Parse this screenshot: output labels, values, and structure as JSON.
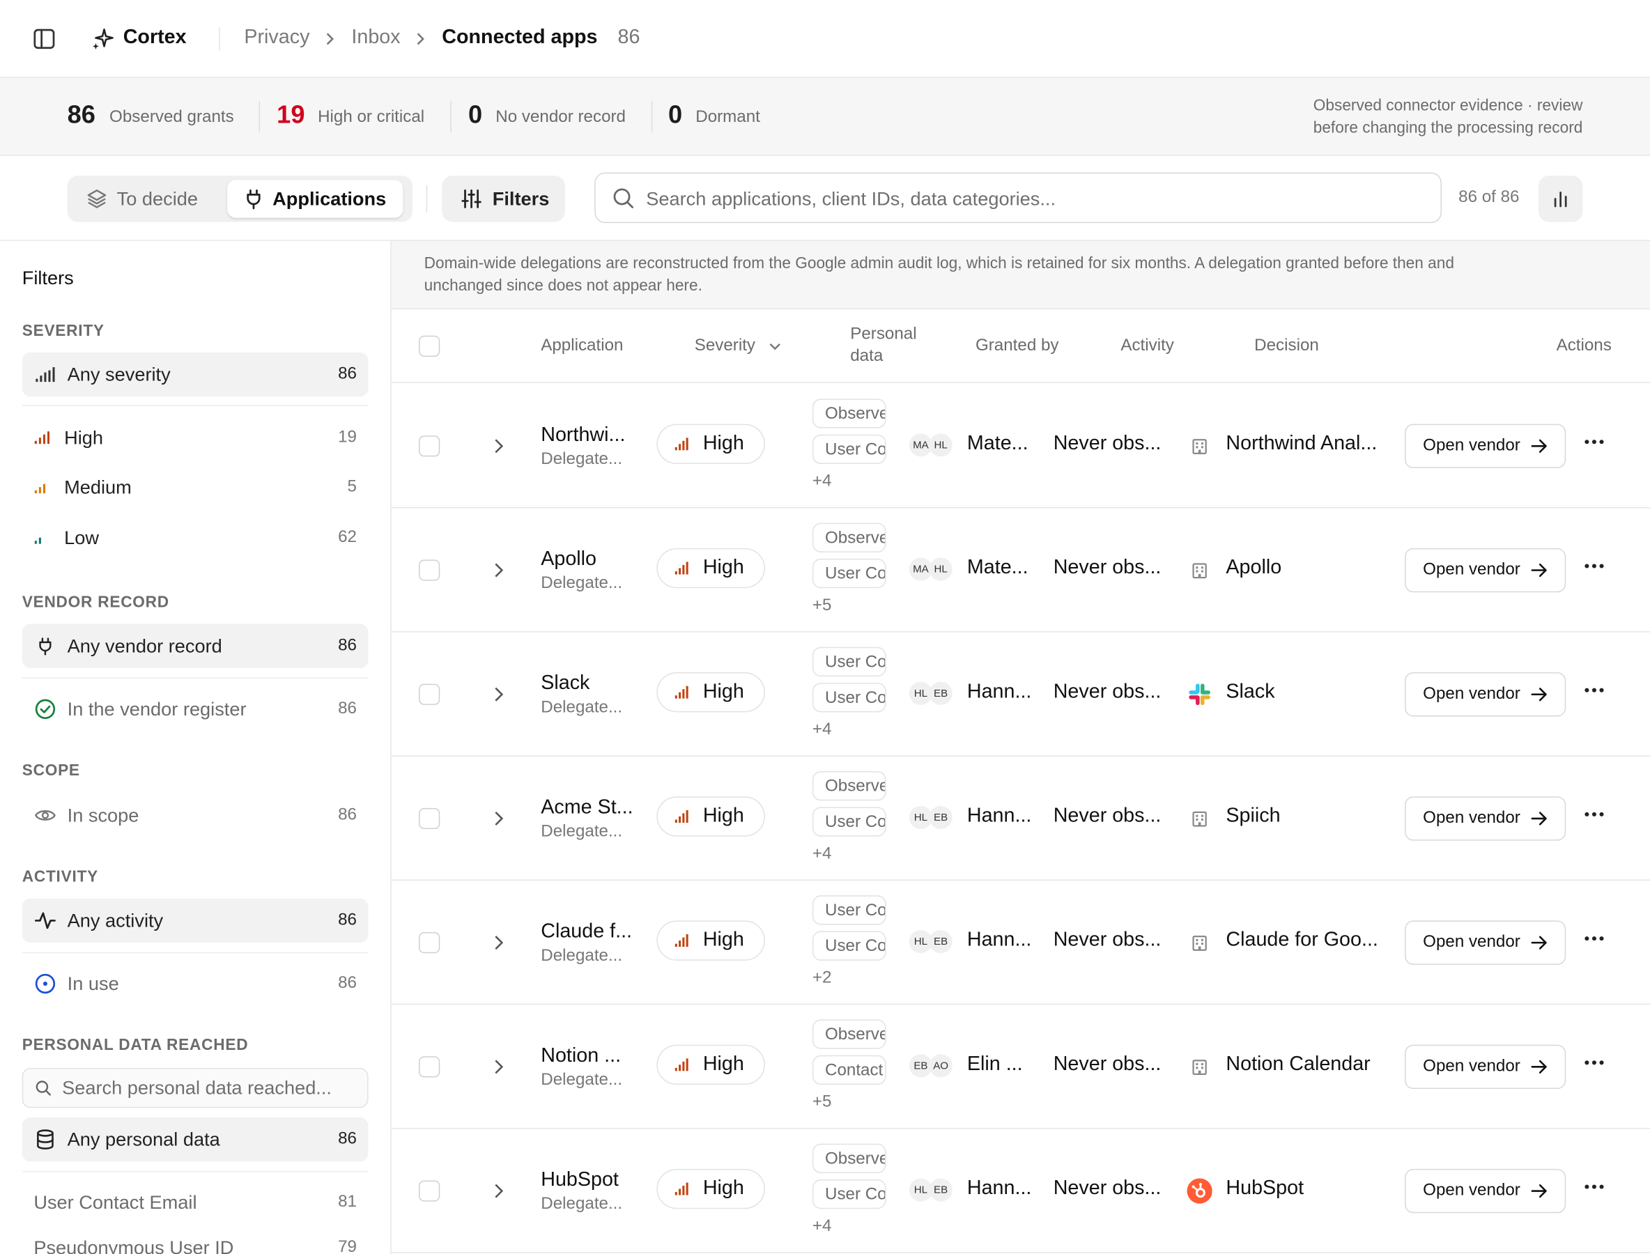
{
  "app": {
    "name": "Cortex"
  },
  "breadcrumb": {
    "items": [
      "Privacy",
      "Inbox"
    ],
    "current": "Connected apps",
    "count": "86"
  },
  "stats": {
    "observed_grants": {
      "value": "86",
      "label": "Observed grants"
    },
    "high_critical": {
      "value": "19",
      "label": "High or critical",
      "color": "#d0021b"
    },
    "no_vendor": {
      "value": "0",
      "label": "No vendor record"
    },
    "dormant": {
      "value": "0",
      "label": "Dormant"
    },
    "notice_line1": "Observed connector evidence · review",
    "notice_line2": "before changing the processing record"
  },
  "toolbar": {
    "tab_to_decide": "To decide",
    "tab_applications": "Applications",
    "filters_label": "Filters",
    "search_placeholder": "Search applications, client IDs, data categories...",
    "result_count": "86 of 86"
  },
  "sidebar": {
    "title": "Filters",
    "severity": {
      "heading": "SEVERITY",
      "all": {
        "label": "Any severity",
        "count": "86"
      },
      "items": [
        {
          "label": "High",
          "count": "19",
          "color": "#c2410c"
        },
        {
          "label": "Medium",
          "count": "5",
          "color": "#d97706"
        },
        {
          "label": "Low",
          "count": "62",
          "color": "#0f766e"
        }
      ]
    },
    "vendor": {
      "heading": "VENDOR RECORD",
      "all": {
        "label": "Any vendor record",
        "count": "86"
      },
      "item": {
        "label": "In the vendor register",
        "count": "86",
        "color": "#15803d"
      }
    },
    "scope": {
      "heading": "SCOPE",
      "item": {
        "label": "In scope",
        "count": "86"
      }
    },
    "activity": {
      "heading": "ACTIVITY",
      "all": {
        "label": "Any activity",
        "count": "86"
      },
      "item": {
        "label": "In use",
        "count": "86",
        "color": "#1d4ed8"
      }
    },
    "personal": {
      "heading": "PERSONAL DATA REACHED",
      "search_placeholder": "Search personal data reached...",
      "all": {
        "label": "Any personal data",
        "count": "86"
      },
      "items": [
        {
          "label": "User Contact Email",
          "count": "81"
        },
        {
          "label": "Pseudonymous User ID",
          "count": "79"
        }
      ]
    }
  },
  "main": {
    "banner_line1": "Domain-wide delegations are reconstructed from the Google admin audit log, which is retained for six months. A delegation granted before then and",
    "banner_line2": "unchanged since does not appear here.",
    "columns": {
      "application": "Application",
      "severity": "Severity",
      "personal_1": "Personal",
      "personal_2": "data",
      "granted_by": "Granted by",
      "activity": "Activity",
      "decision": "Decision",
      "actions": "Actions"
    },
    "open_vendor_label": "Open vendor",
    "rows": [
      {
        "name": "Northwi...",
        "sub": "Delegate...",
        "severity": "High",
        "data1": "Observed",
        "data2": "User Contact",
        "more": "+4",
        "av1": "MA",
        "av2": "HL",
        "granted": "Mate...",
        "activity": "Never obs...",
        "decision": "Northwind Anal...",
        "icon": "building-icon"
      },
      {
        "name": "Apollo",
        "sub": "Delegate...",
        "severity": "High",
        "data1": "Observed",
        "data2": "User Contact",
        "more": "+5",
        "av1": "MA",
        "av2": "HL",
        "granted": "Mate...",
        "activity": "Never obs...",
        "decision": "Apollo",
        "icon": "building-icon"
      },
      {
        "name": "Slack",
        "sub": "Delegate...",
        "severity": "High",
        "data1": "User Contact",
        "data2": "User Contact",
        "more": "+4",
        "av1": "HL",
        "av2": "EB",
        "granted": "Hann...",
        "activity": "Never obs...",
        "decision": "Slack",
        "icon": "slack-logo-icon"
      },
      {
        "name": "Acme St...",
        "sub": "Delegate...",
        "severity": "High",
        "data1": "Observed",
        "data2": "User Contact",
        "more": "+4",
        "av1": "HL",
        "av2": "EB",
        "granted": "Hann...",
        "activity": "Never obs...",
        "decision": "Spiich",
        "icon": "building-icon"
      },
      {
        "name": "Claude f...",
        "sub": "Delegate...",
        "severity": "High",
        "data1": "User Contact",
        "data2": "User Contact",
        "more": "+2",
        "av1": "HL",
        "av2": "EB",
        "granted": "Hann...",
        "activity": "Never obs...",
        "decision": "Claude for Goo...",
        "icon": "building-icon"
      },
      {
        "name": "Notion ...",
        "sub": "Delegate...",
        "severity": "High",
        "data1": "Observed",
        "data2": "Contact",
        "more": "+5",
        "av1": "EB",
        "av2": "AO",
        "granted": "Elin ...",
        "activity": "Never obs...",
        "decision": "Notion Calendar",
        "icon": "building-icon"
      },
      {
        "name": "HubSpot",
        "sub": "Delegate...",
        "severity": "High",
        "data1": "Observed",
        "data2": "User Contact",
        "more": "+4",
        "av1": "HL",
        "av2": "EB",
        "granted": "Hann...",
        "activity": "Never obs...",
        "decision": "HubSpot",
        "icon": "hubspot-logo-icon"
      }
    ]
  }
}
